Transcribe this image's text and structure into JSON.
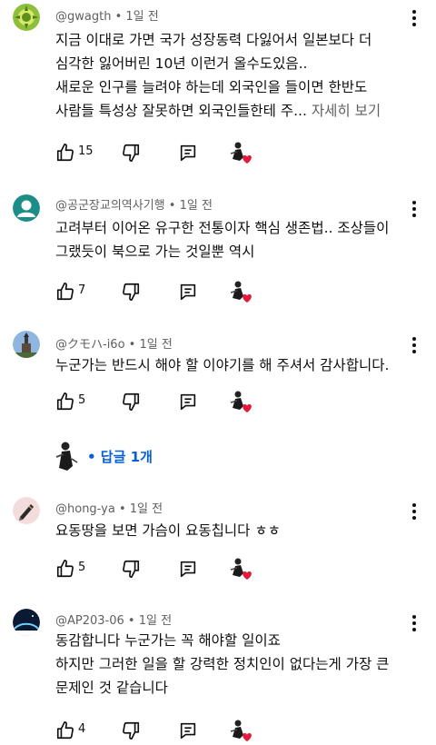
{
  "comments": [
    {
      "author": "@gwagth",
      "time": "1일 전",
      "lines": [
        "지금 이대로 가면 국가 성장동력 다잃어서 일본보다 더",
        "심각한 잃어버린 10년 이런거 올수도있음..",
        "새로운 인구를 늘려야 하는데 외국인을 들이면 한반도",
        "사람들 특성상 잘못하면 외국인들한테 주..."
      ],
      "read_more": "자세히 보기",
      "likes": "15"
    },
    {
      "author": "@공군장교의역사기행",
      "time": "1일 전",
      "lines": [
        "고려부터 이어온 유구한 전통이자 핵심 생존법.. 조상들이",
        "그랬듯이 북으로 가는 것일뿐 역시"
      ],
      "likes": "7"
    },
    {
      "author": "@クモハ-i6o",
      "time": "1일 전",
      "lines": [
        "누군가는 반드시 해야 할 이야기를 해 주셔서 감사합니다."
      ],
      "likes": "5"
    },
    {
      "author": "@hong-ya",
      "time": "1일 전",
      "lines": [
        "요동땅을 보면 가슴이 요동칩니다 ㅎㅎ"
      ],
      "likes": "5"
    },
    {
      "author": "@AP203-06",
      "time": "1일 전",
      "lines": [
        "동감합니다 누군가는 꼭 해야할 일이죠",
        "하지만 그러한 일을 할 강력한 정치인이 없다는게 가장 큰",
        "문제인 것 같습니다"
      ],
      "likes": "4"
    }
  ],
  "replies": {
    "label": "• 답글 1개"
  },
  "meta_separator": " • ",
  "icons": {
    "like": "thumb-up-icon",
    "dislike": "thumb-down-icon",
    "reply": "reply-icon",
    "creator_heart": "creator-heart-icon",
    "more": "more-vertical-icon"
  },
  "colors": {
    "text": "#0f0f0f",
    "secondary": "#606060",
    "link": "#065fd4",
    "heart": "#e3183a"
  }
}
